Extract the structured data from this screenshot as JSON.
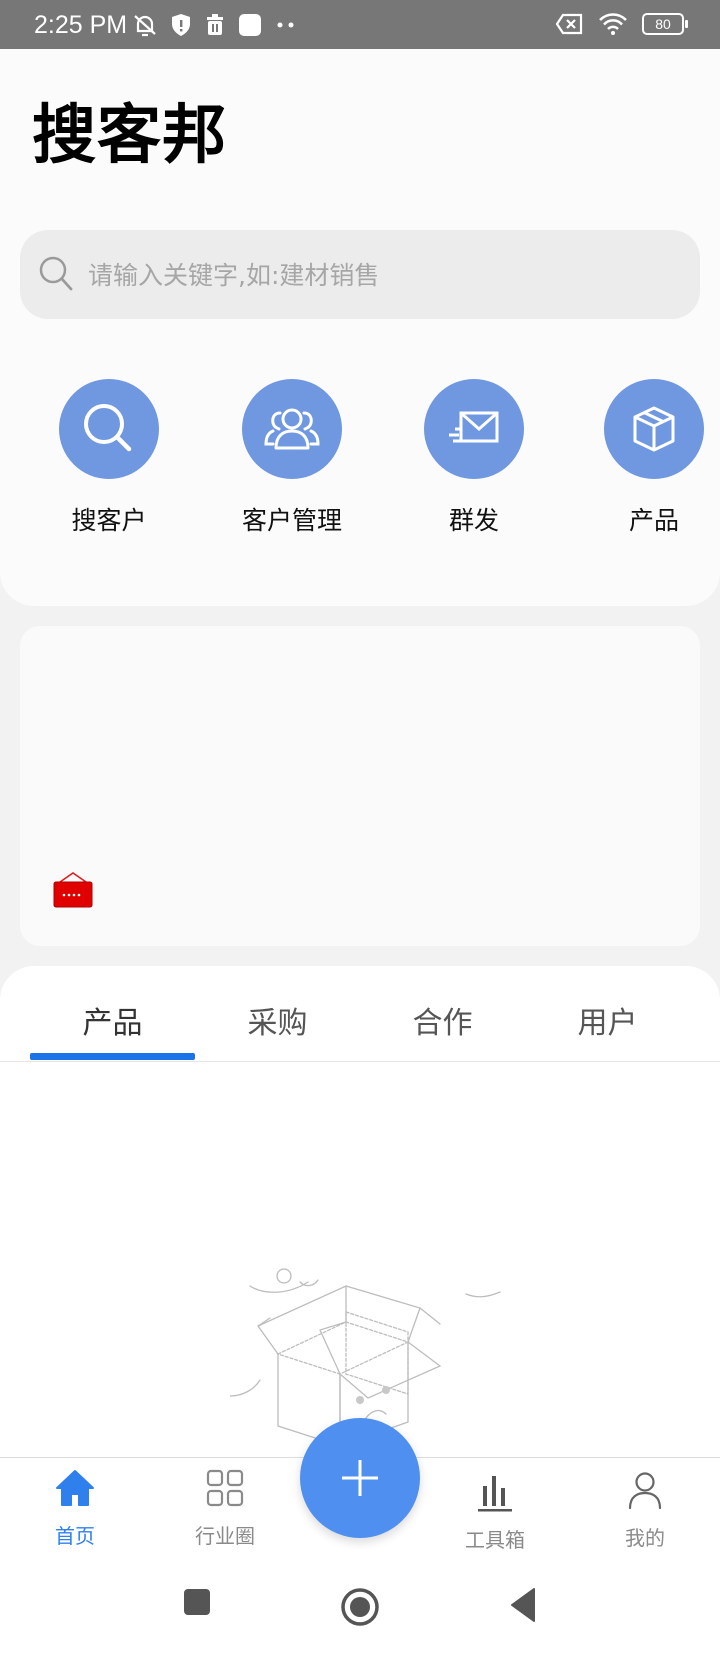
{
  "status_bar": {
    "time": "2:25 PM",
    "battery": "80",
    "icons": [
      "notifications-off-icon",
      "shield-icon",
      "trash-icon",
      "square-icon",
      "more-dots-icon",
      "sim-x-icon",
      "wifi-icon",
      "battery-icon"
    ]
  },
  "header": {
    "title": "搜客邦"
  },
  "search": {
    "placeholder": "请输入关键字,如:建材销售",
    "icon": "search-icon"
  },
  "quick_actions": [
    {
      "label": "搜客户",
      "icon": "search-icon"
    },
    {
      "label": "客户管理",
      "icon": "users-icon"
    },
    {
      "label": "群发",
      "icon": "mail-send-icon"
    },
    {
      "label": "产品",
      "icon": "box-icon"
    }
  ],
  "colors": {
    "accent": "#6f98e0",
    "tab_indicator": "#1a73e8",
    "fab": "#4f8ff0",
    "nav_active": "#2f80ed"
  },
  "tabs": [
    {
      "label": "产品",
      "active": true
    },
    {
      "label": "采购",
      "active": false
    },
    {
      "label": "合作",
      "active": false
    },
    {
      "label": "用户",
      "active": false
    }
  ],
  "bottom_nav": [
    {
      "label": "首页",
      "icon": "home-icon",
      "active": true
    },
    {
      "label": "行业圈",
      "icon": "grid-icon",
      "active": false
    },
    {
      "label": "工具箱",
      "icon": "bar-chart-icon",
      "active": false
    },
    {
      "label": "我的",
      "icon": "user-icon",
      "active": false
    }
  ],
  "fab": {
    "icon": "plus-icon"
  },
  "system_nav": [
    "recents-icon",
    "home-circle-icon",
    "back-icon"
  ]
}
